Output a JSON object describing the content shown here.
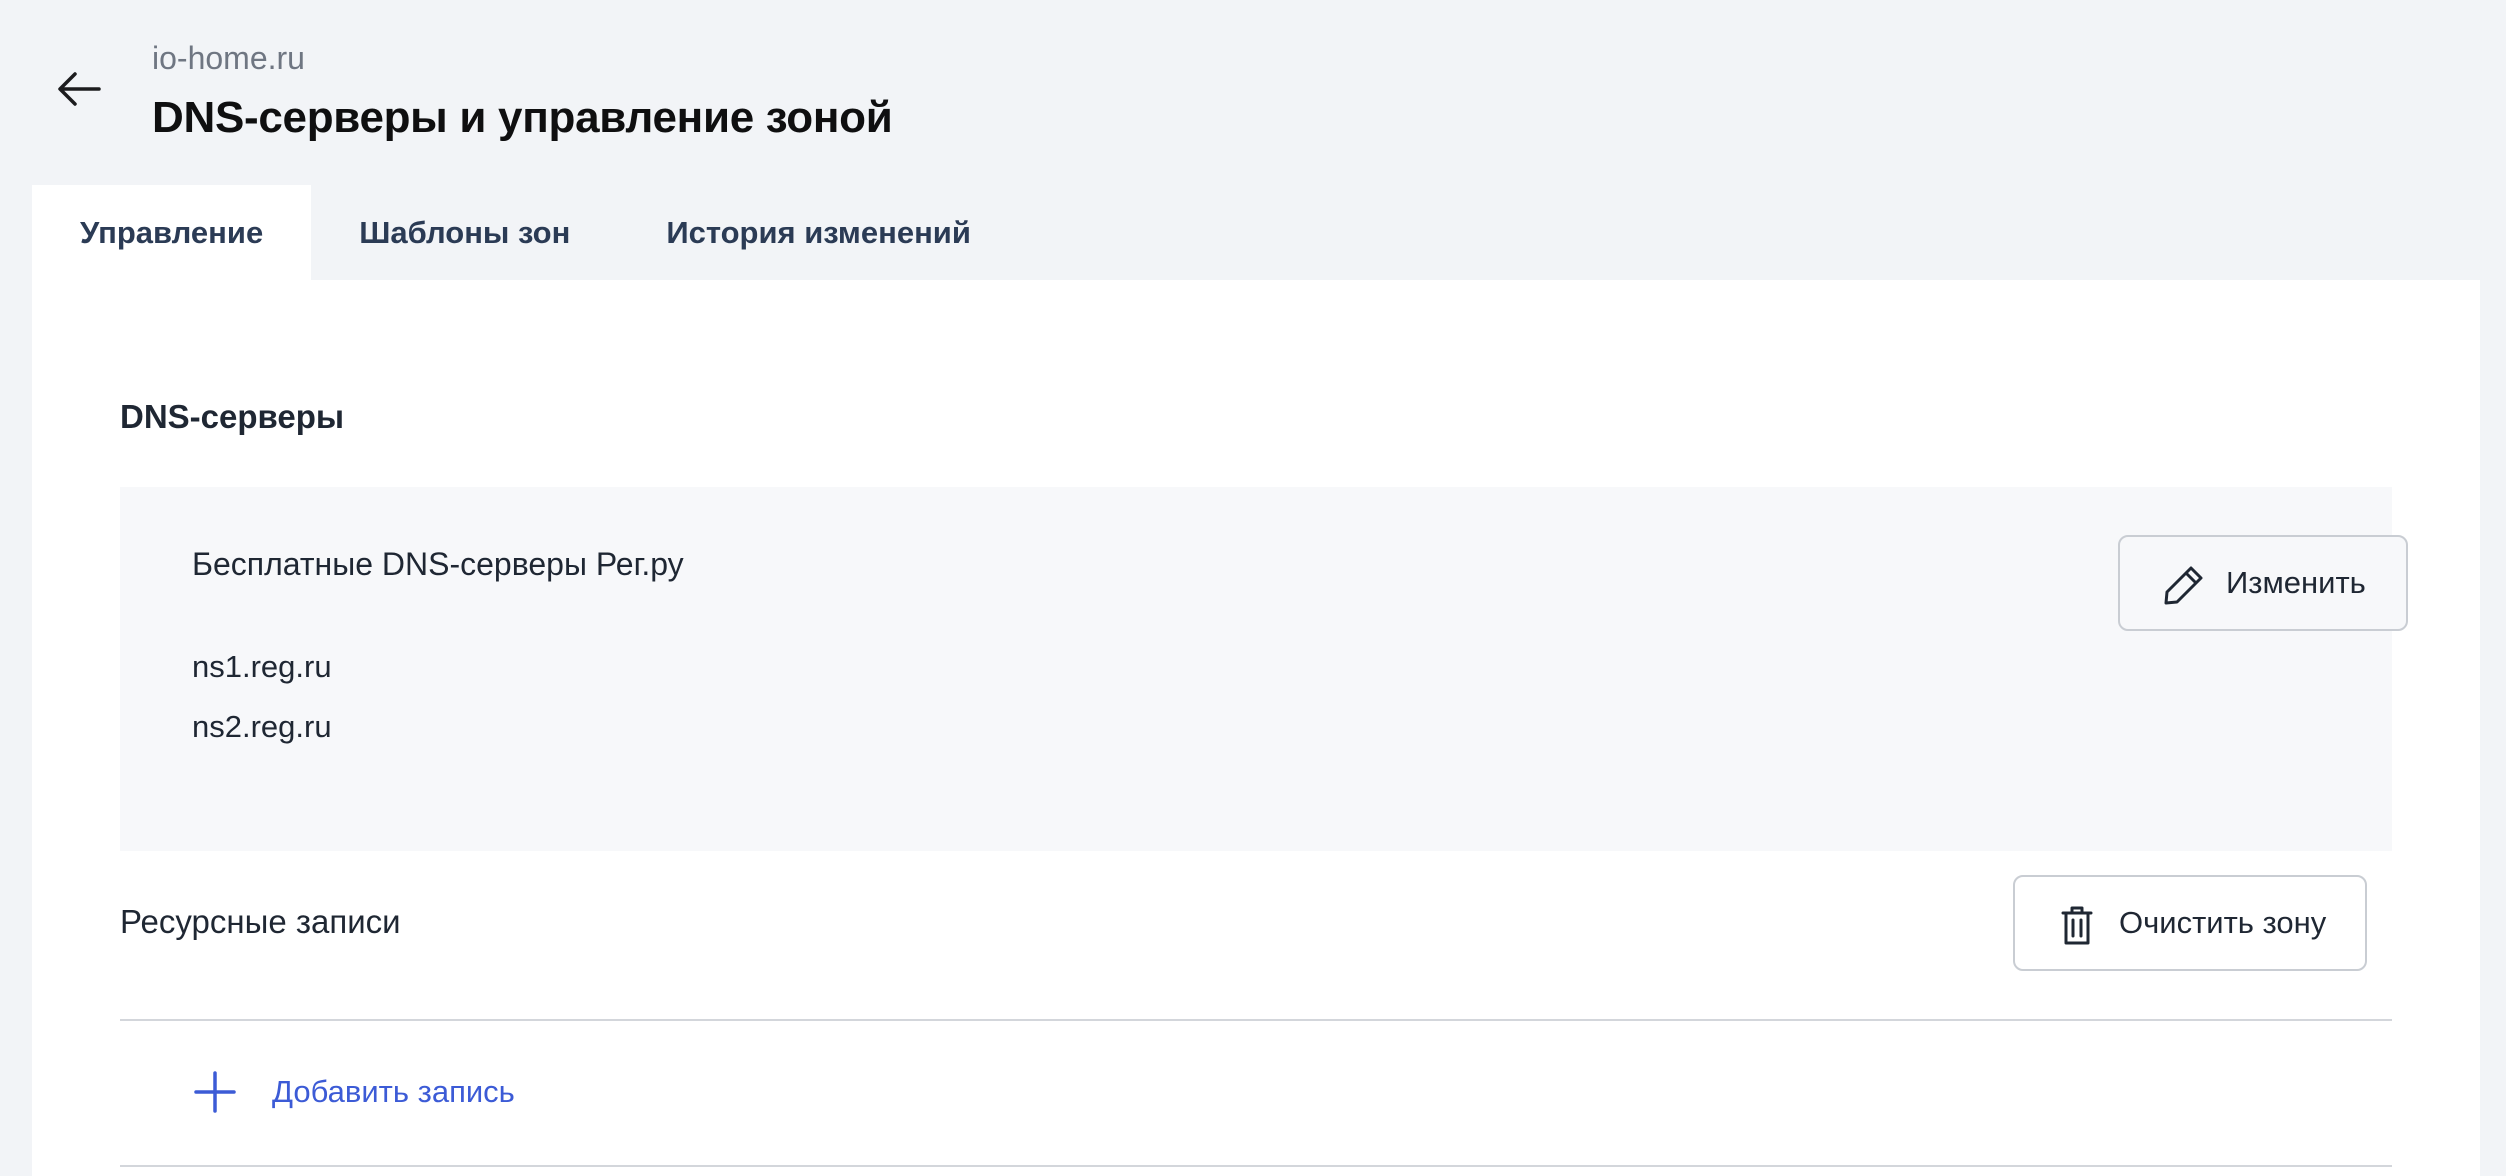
{
  "header": {
    "back_icon": "arrow-left-icon",
    "domain": "io-home.ru",
    "title": "DNS-серверы и управление зоной"
  },
  "tabs": [
    {
      "label": "Управление",
      "active": true
    },
    {
      "label": "Шаблоны зон",
      "active": false
    },
    {
      "label": "История изменений",
      "active": false
    }
  ],
  "dns_servers": {
    "section_title": "DNS-серверы",
    "provider": "Бесплатные DNS-серверы Рег.ру",
    "nameservers": [
      "ns1.reg.ru",
      "ns2.reg.ru"
    ],
    "edit_button": {
      "label": "Изменить",
      "icon": "pencil-icon"
    }
  },
  "resource_records": {
    "section_title": "Ресурсные записи",
    "clear_button": {
      "label": "Очистить зону",
      "icon": "trash-icon"
    },
    "add_record": {
      "label": "Добавить запись",
      "icon": "plus-icon"
    }
  },
  "colors": {
    "page_background": "#f2f4f7",
    "panel_background": "#ffffff",
    "dns_box_background": "#f7f8fa",
    "tab_text": "#2b3b55",
    "link_accent": "#3c5bd6",
    "border": "#c9cdd3"
  }
}
